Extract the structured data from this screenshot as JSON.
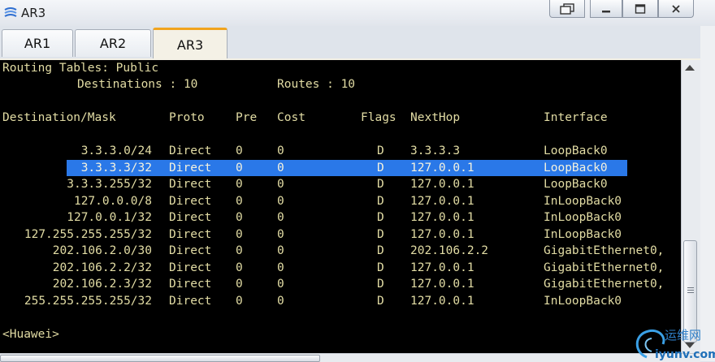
{
  "window": {
    "title": "AR3"
  },
  "tabs": [
    {
      "label": "AR1"
    },
    {
      "label": "AR2"
    },
    {
      "label": "AR3",
      "active": true
    }
  ],
  "terminal": {
    "heading": "Routing Tables: Public",
    "summary": {
      "destinations_label": "Destinations : 10",
      "routes_label": "Routes : 10"
    },
    "columns": [
      "Destination/Mask",
      "Proto",
      "Pre",
      "Cost",
      "Flags",
      "NextHop",
      "Interface"
    ],
    "rows": [
      [
        "3.3.3.0/24",
        "Direct",
        "0",
        "0",
        "D",
        "3.3.3.3",
        "LoopBack0"
      ],
      [
        "3.3.3.3/32",
        "Direct",
        "0",
        "0",
        "D",
        "127.0.0.1",
        "LoopBack0"
      ],
      [
        "3.3.3.255/32",
        "Direct",
        "0",
        "0",
        "D",
        "127.0.0.1",
        "LoopBack0"
      ],
      [
        "127.0.0.0/8",
        "Direct",
        "0",
        "0",
        "D",
        "127.0.0.1",
        "InLoopBack0"
      ],
      [
        "127.0.0.1/32",
        "Direct",
        "0",
        "0",
        "D",
        "127.0.0.1",
        "InLoopBack0"
      ],
      [
        "127.255.255.255/32",
        "Direct",
        "0",
        "0",
        "D",
        "127.0.0.1",
        "InLoopBack0"
      ],
      [
        "202.106.2.0/30",
        "Direct",
        "0",
        "0",
        "D",
        "202.106.2.2",
        "GigabitEthernet0,"
      ],
      [
        "202.106.2.2/32",
        "Direct",
        "0",
        "0",
        "D",
        "127.0.0.1",
        "GigabitEthernet0,"
      ],
      [
        "202.106.2.3/32",
        "Direct",
        "0",
        "0",
        "D",
        "127.0.0.1",
        "GigabitEthernet0,"
      ],
      [
        "255.255.255.255/32",
        "Direct",
        "0",
        "0",
        "D",
        "127.0.0.1",
        "InLoopBack0"
      ]
    ],
    "selected_row": 1,
    "prompt": "<Huawei>"
  },
  "watermark": {
    "brand": "运维网",
    "url": "iyunv.com"
  },
  "colors": {
    "terminal_bg": "#000000",
    "terminal_text": "#e2dca4",
    "selection": "#2a78e8",
    "active_tab_accent": "#f1a41e"
  },
  "icons": [
    "app-icon",
    "restore-icon",
    "minimize-icon",
    "maximize-icon",
    "close-icon"
  ]
}
